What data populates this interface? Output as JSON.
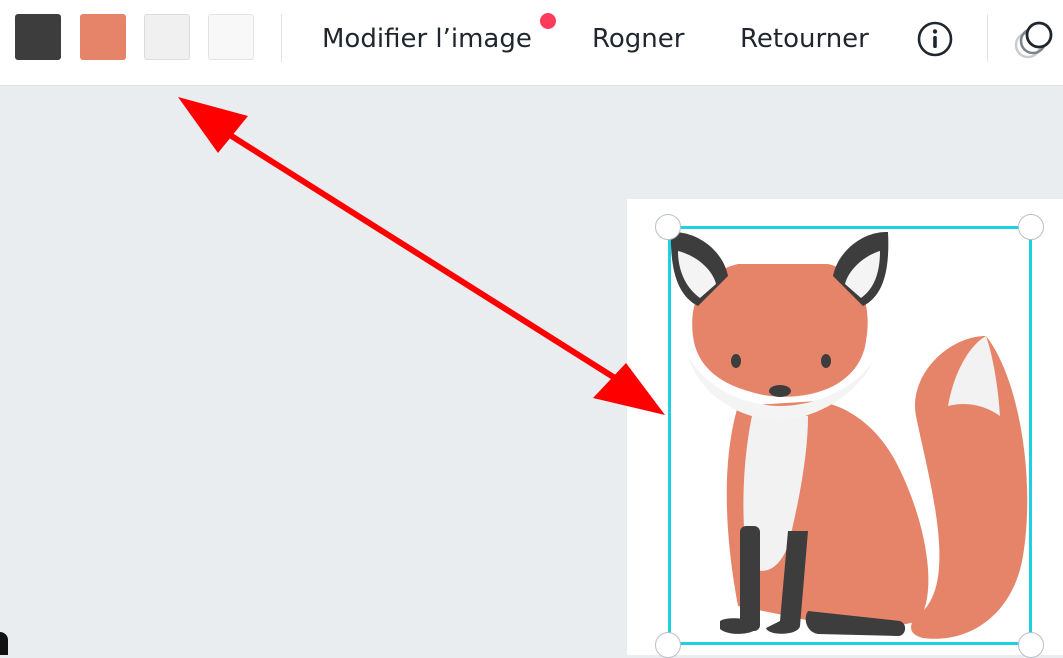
{
  "toolbar": {
    "swatches": [
      {
        "name": "dark-gray",
        "color": "#3d3d3d"
      },
      {
        "name": "orange",
        "color": "#e6846a"
      },
      {
        "name": "light-gray",
        "color": "#f0f0f0"
      },
      {
        "name": "off-white",
        "color": "#f8f8f8"
      }
    ],
    "edit_image_label": "Modifier l’image",
    "crop_label": "Rogner",
    "flip_label": "Retourner",
    "info_icon": "info-icon",
    "transparency_icon": "transparency-icon",
    "notification_color": "#ff3b5b"
  },
  "canvas": {
    "background": "#eaedf0",
    "page_background": "#ffffff",
    "selection_color": "#1fd1e0",
    "image_subject": "fox",
    "annotation_arrow_color": "#ff0000"
  }
}
